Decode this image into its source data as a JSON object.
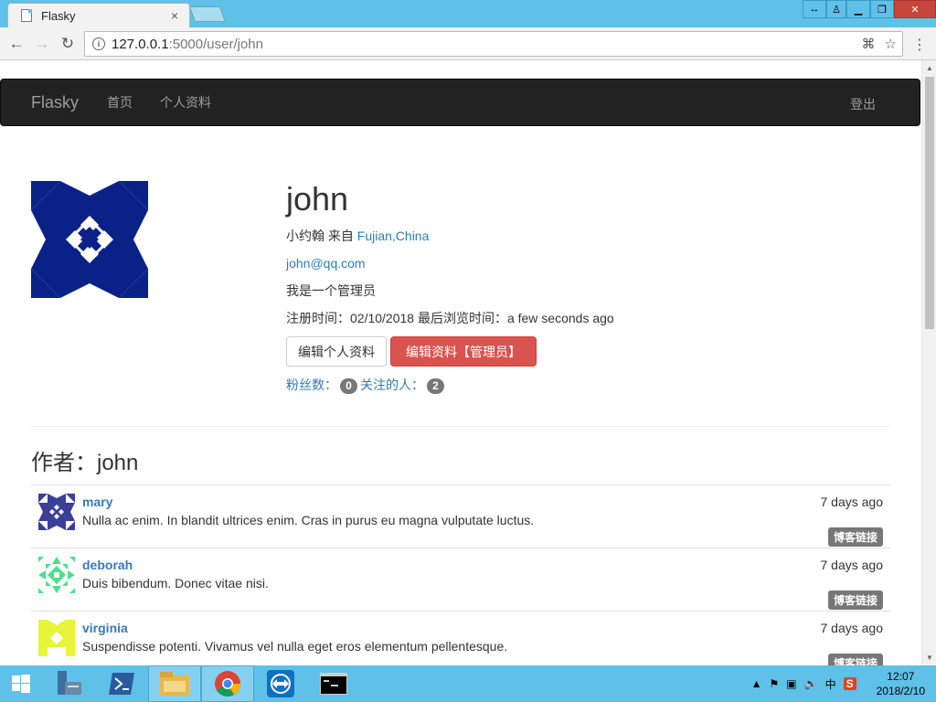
{
  "browser": {
    "tab_title": "Flasky",
    "tab_close": "×",
    "url_host": "127.0.0.1",
    "url_path": ":5000/user/john"
  },
  "navbar": {
    "brand": "Flasky",
    "links": [
      "首页",
      "个人资料"
    ],
    "logout": "登出"
  },
  "profile": {
    "username": "john",
    "realname_prefix": "小约翰 来自 ",
    "location": "Fujian,China",
    "email": "john@qq.com",
    "about": "我是一个管理员",
    "since_text": "注册时间：02/10/2018 最后浏览时间：a few seconds ago",
    "edit_button": "编辑个人资料",
    "admin_edit_button": "编辑资料【管理员】",
    "followers_label": "粉丝数：",
    "followers_count": "0",
    "following_label": "关注的人：",
    "following_count": "2"
  },
  "author_heading": "作者：john",
  "posts": [
    {
      "author": "mary",
      "date": "7 days ago",
      "body": "Nulla ac enim. In blandit ultrices enim. Cras in purus eu magna vulputate luctus.",
      "label": "博客链接",
      "color": "#3b3f9a"
    },
    {
      "author": "deborah",
      "date": "7 days ago",
      "body": "Duis bibendum. Donec vitae nisi.",
      "label": "博客链接",
      "color": "#4de08a"
    },
    {
      "author": "virginia",
      "date": "7 days ago",
      "body": "Suspendisse potenti. Vivamus vel nulla eget eros elementum pellentesque.",
      "label": "博客链接",
      "color": "#e8f43a"
    }
  ],
  "taskbar": {
    "time": "12:07",
    "date": "2018/2/10",
    "ime": "中"
  },
  "colors": {
    "avatar": "#0a2288",
    "navbar": "#222222",
    "danger": "#d9534f",
    "link": "#337ab7"
  }
}
